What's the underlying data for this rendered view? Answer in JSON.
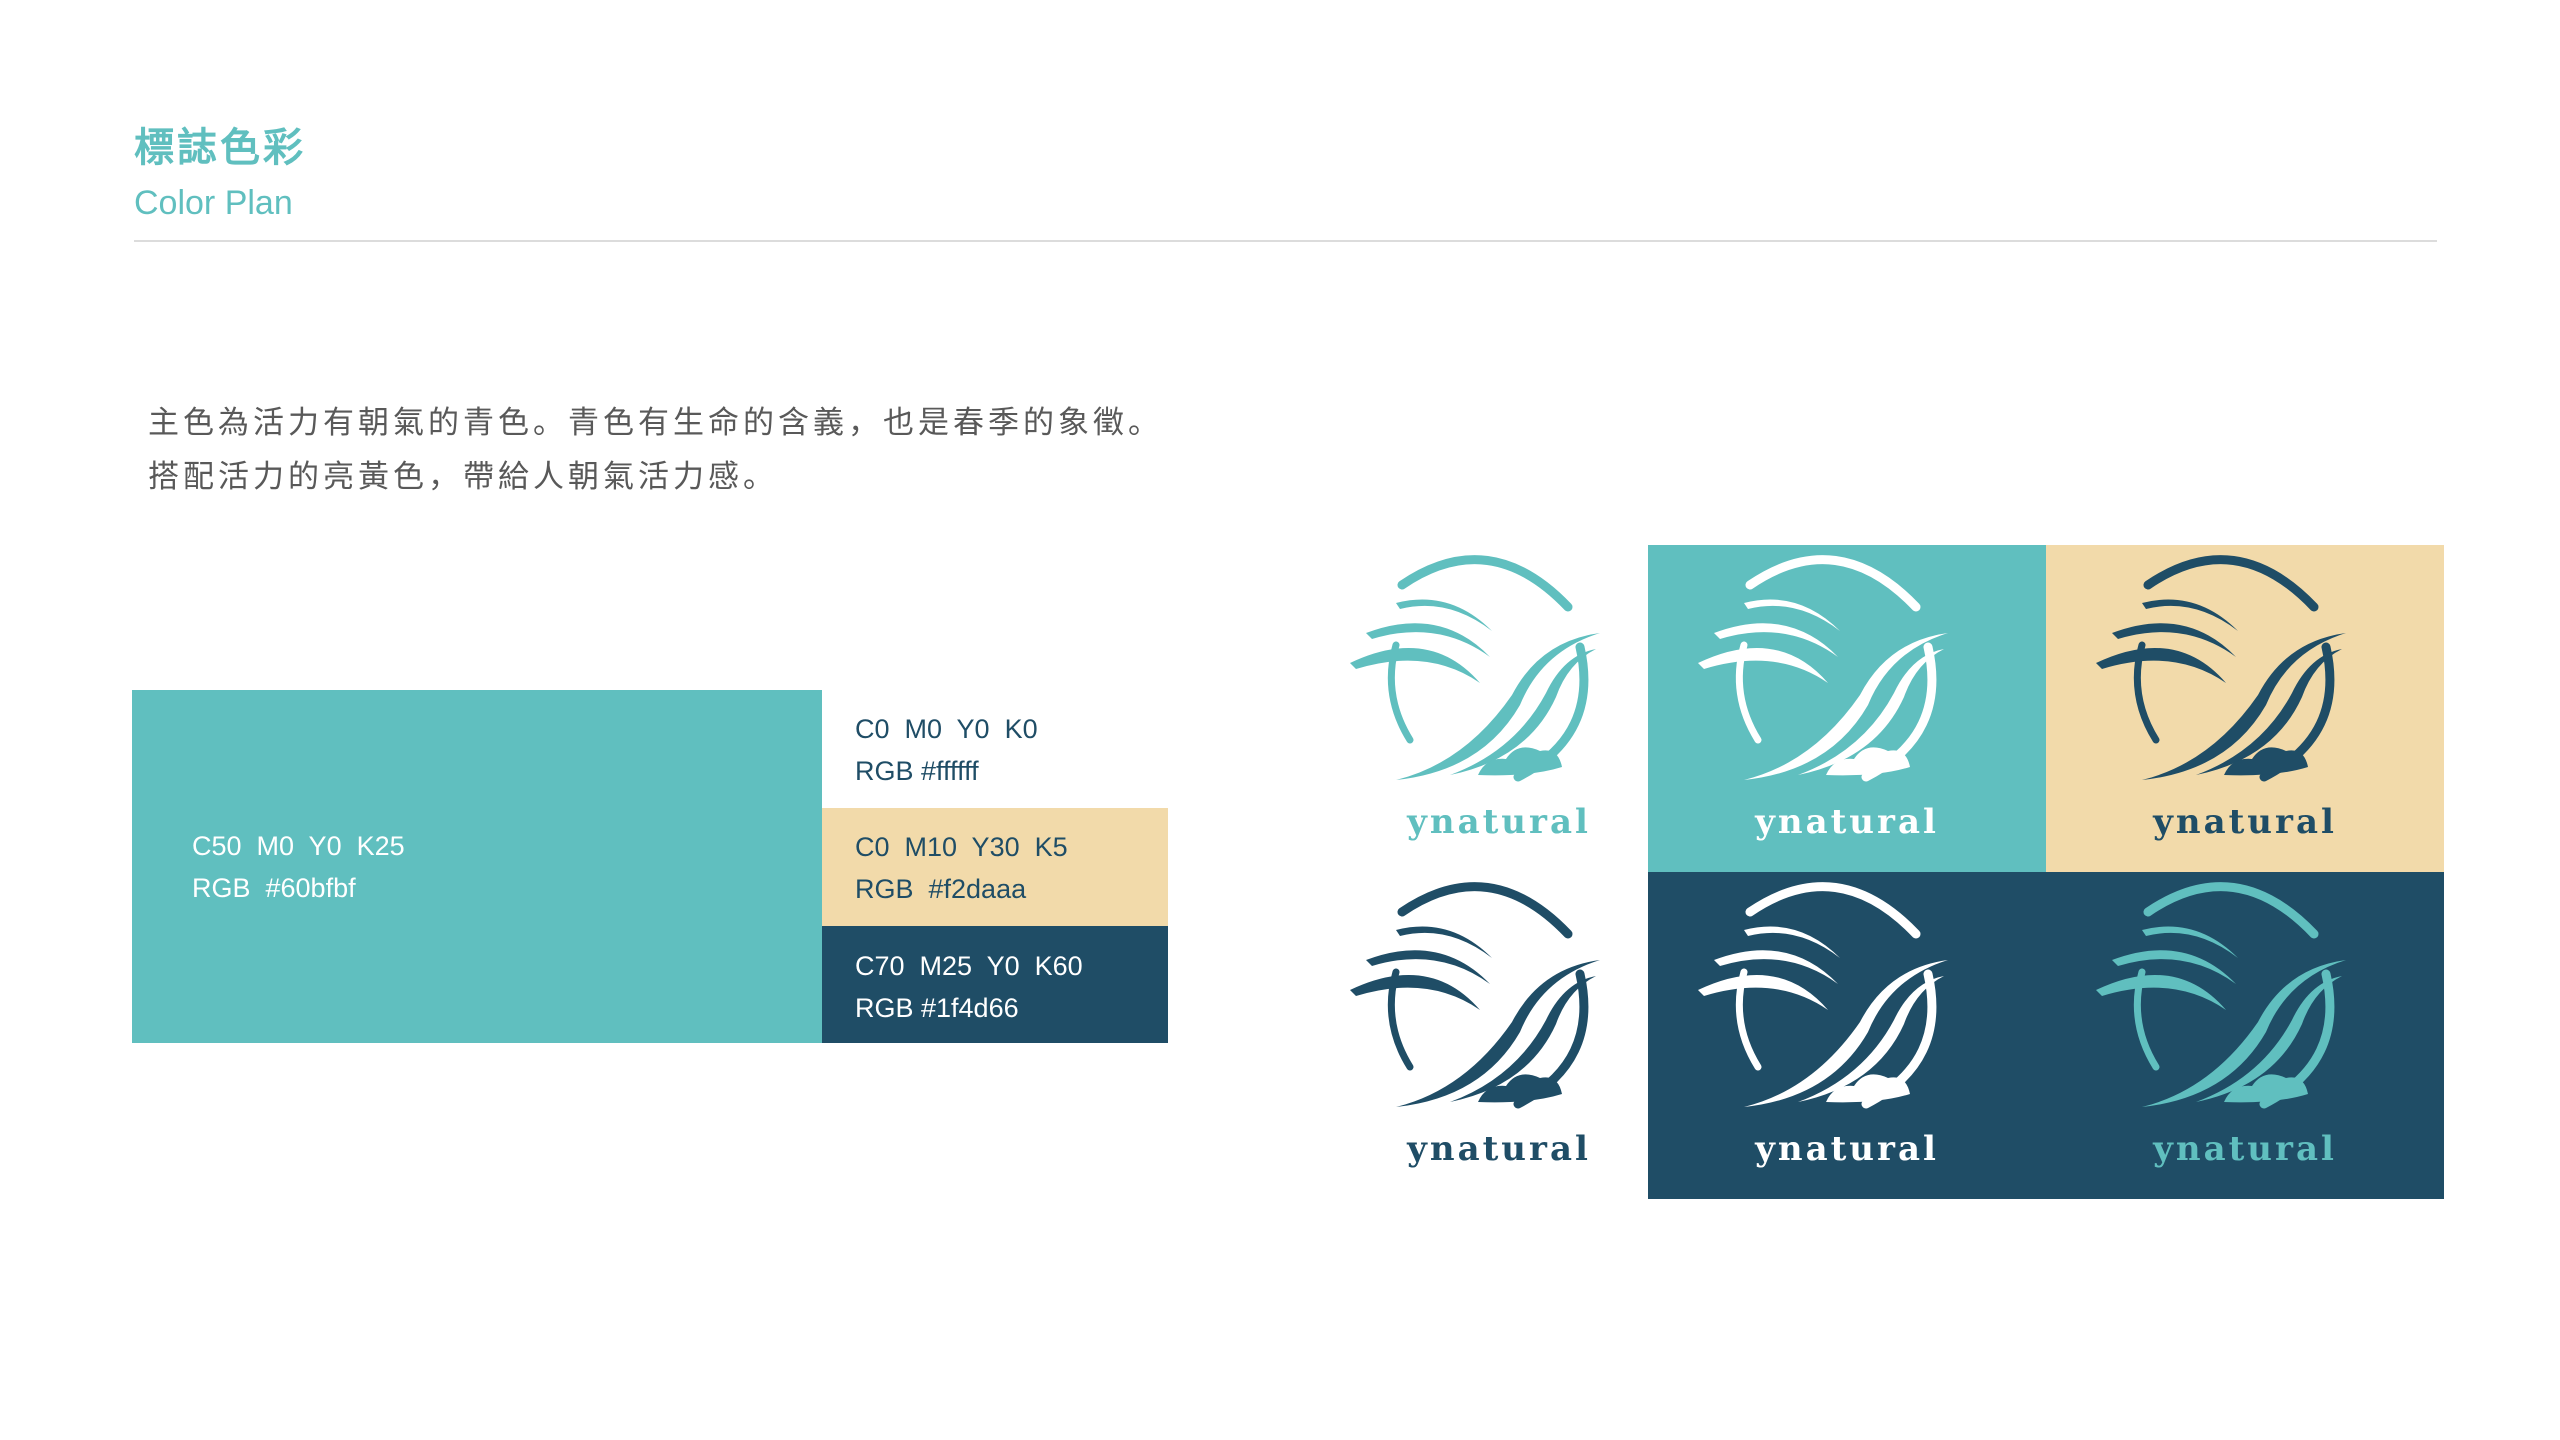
{
  "header": {
    "title_zh": "標誌色彩",
    "title_en": "Color Plan"
  },
  "description": {
    "line1": "主色為活力有朝氣的青色。青色有生命的含義，也是春季的象徵。",
    "line2": "搭配活力的亮黃色，帶給人朝氣活力感。"
  },
  "swatches": [
    {
      "id": "main",
      "cmyk": "C50  M0  Y0  K25",
      "rgb": "RGB  #60bfbf",
      "color": "#60bfbf"
    },
    {
      "id": "white",
      "cmyk": "C0  M0  Y0  K0",
      "rgb": "RGB #ffffff",
      "color": "#ffffff"
    },
    {
      "id": "yellow",
      "cmyk": "C0  M10  Y30  K5",
      "rgb": "RGB  #f2daaa",
      "color": "#f2daaa"
    },
    {
      "id": "navy",
      "cmyk": "C70  M25  Y0  K60",
      "rgb": "RGB #1f4d66",
      "color": "#1f4d66"
    }
  ],
  "logos": {
    "brand_name": "ynatural",
    "variants": [
      {
        "bg": "#ffffff",
        "mark": "#60bfbf"
      },
      {
        "bg": "#60bfbf",
        "mark": "#ffffff"
      },
      {
        "bg": "#f2daaa",
        "mark": "#1f4d66"
      },
      {
        "bg": "#ffffff",
        "mark": "#1f4d66"
      },
      {
        "bg": "#1f4d66",
        "mark": "#ffffff"
      },
      {
        "bg": "#1f4d66",
        "mark": "#60bfbf"
      }
    ]
  }
}
